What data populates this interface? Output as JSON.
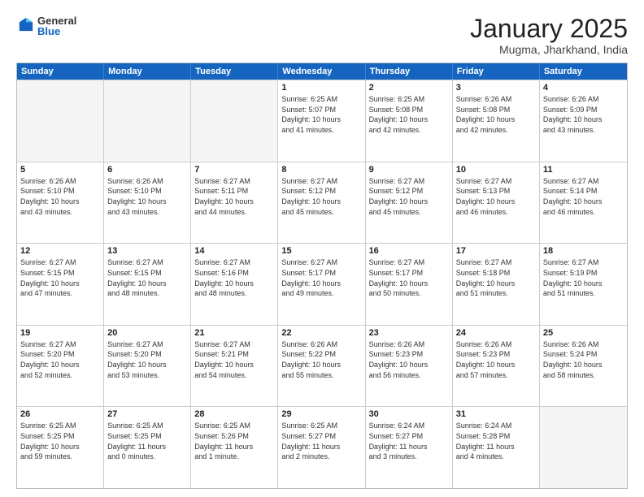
{
  "logo": {
    "general": "General",
    "blue": "Blue"
  },
  "header": {
    "month": "January 2025",
    "location": "Mugma, Jharkhand, India"
  },
  "days": [
    "Sunday",
    "Monday",
    "Tuesday",
    "Wednesday",
    "Thursday",
    "Friday",
    "Saturday"
  ],
  "weeks": [
    [
      {
        "day": "",
        "info": ""
      },
      {
        "day": "",
        "info": ""
      },
      {
        "day": "",
        "info": ""
      },
      {
        "day": "1",
        "info": "Sunrise: 6:25 AM\nSunset: 5:07 PM\nDaylight: 10 hours\nand 41 minutes."
      },
      {
        "day": "2",
        "info": "Sunrise: 6:25 AM\nSunset: 5:08 PM\nDaylight: 10 hours\nand 42 minutes."
      },
      {
        "day": "3",
        "info": "Sunrise: 6:26 AM\nSunset: 5:08 PM\nDaylight: 10 hours\nand 42 minutes."
      },
      {
        "day": "4",
        "info": "Sunrise: 6:26 AM\nSunset: 5:09 PM\nDaylight: 10 hours\nand 43 minutes."
      }
    ],
    [
      {
        "day": "5",
        "info": "Sunrise: 6:26 AM\nSunset: 5:10 PM\nDaylight: 10 hours\nand 43 minutes."
      },
      {
        "day": "6",
        "info": "Sunrise: 6:26 AM\nSunset: 5:10 PM\nDaylight: 10 hours\nand 43 minutes."
      },
      {
        "day": "7",
        "info": "Sunrise: 6:27 AM\nSunset: 5:11 PM\nDaylight: 10 hours\nand 44 minutes."
      },
      {
        "day": "8",
        "info": "Sunrise: 6:27 AM\nSunset: 5:12 PM\nDaylight: 10 hours\nand 45 minutes."
      },
      {
        "day": "9",
        "info": "Sunrise: 6:27 AM\nSunset: 5:12 PM\nDaylight: 10 hours\nand 45 minutes."
      },
      {
        "day": "10",
        "info": "Sunrise: 6:27 AM\nSunset: 5:13 PM\nDaylight: 10 hours\nand 46 minutes."
      },
      {
        "day": "11",
        "info": "Sunrise: 6:27 AM\nSunset: 5:14 PM\nDaylight: 10 hours\nand 46 minutes."
      }
    ],
    [
      {
        "day": "12",
        "info": "Sunrise: 6:27 AM\nSunset: 5:15 PM\nDaylight: 10 hours\nand 47 minutes."
      },
      {
        "day": "13",
        "info": "Sunrise: 6:27 AM\nSunset: 5:15 PM\nDaylight: 10 hours\nand 48 minutes."
      },
      {
        "day": "14",
        "info": "Sunrise: 6:27 AM\nSunset: 5:16 PM\nDaylight: 10 hours\nand 48 minutes."
      },
      {
        "day": "15",
        "info": "Sunrise: 6:27 AM\nSunset: 5:17 PM\nDaylight: 10 hours\nand 49 minutes."
      },
      {
        "day": "16",
        "info": "Sunrise: 6:27 AM\nSunset: 5:17 PM\nDaylight: 10 hours\nand 50 minutes."
      },
      {
        "day": "17",
        "info": "Sunrise: 6:27 AM\nSunset: 5:18 PM\nDaylight: 10 hours\nand 51 minutes."
      },
      {
        "day": "18",
        "info": "Sunrise: 6:27 AM\nSunset: 5:19 PM\nDaylight: 10 hours\nand 51 minutes."
      }
    ],
    [
      {
        "day": "19",
        "info": "Sunrise: 6:27 AM\nSunset: 5:20 PM\nDaylight: 10 hours\nand 52 minutes."
      },
      {
        "day": "20",
        "info": "Sunrise: 6:27 AM\nSunset: 5:20 PM\nDaylight: 10 hours\nand 53 minutes."
      },
      {
        "day": "21",
        "info": "Sunrise: 6:27 AM\nSunset: 5:21 PM\nDaylight: 10 hours\nand 54 minutes."
      },
      {
        "day": "22",
        "info": "Sunrise: 6:26 AM\nSunset: 5:22 PM\nDaylight: 10 hours\nand 55 minutes."
      },
      {
        "day": "23",
        "info": "Sunrise: 6:26 AM\nSunset: 5:23 PM\nDaylight: 10 hours\nand 56 minutes."
      },
      {
        "day": "24",
        "info": "Sunrise: 6:26 AM\nSunset: 5:23 PM\nDaylight: 10 hours\nand 57 minutes."
      },
      {
        "day": "25",
        "info": "Sunrise: 6:26 AM\nSunset: 5:24 PM\nDaylight: 10 hours\nand 58 minutes."
      }
    ],
    [
      {
        "day": "26",
        "info": "Sunrise: 6:25 AM\nSunset: 5:25 PM\nDaylight: 10 hours\nand 59 minutes."
      },
      {
        "day": "27",
        "info": "Sunrise: 6:25 AM\nSunset: 5:25 PM\nDaylight: 11 hours\nand 0 minutes."
      },
      {
        "day": "28",
        "info": "Sunrise: 6:25 AM\nSunset: 5:26 PM\nDaylight: 11 hours\nand 1 minute."
      },
      {
        "day": "29",
        "info": "Sunrise: 6:25 AM\nSunset: 5:27 PM\nDaylight: 11 hours\nand 2 minutes."
      },
      {
        "day": "30",
        "info": "Sunrise: 6:24 AM\nSunset: 5:27 PM\nDaylight: 11 hours\nand 3 minutes."
      },
      {
        "day": "31",
        "info": "Sunrise: 6:24 AM\nSunset: 5:28 PM\nDaylight: 11 hours\nand 4 minutes."
      },
      {
        "day": "",
        "info": ""
      }
    ]
  ]
}
